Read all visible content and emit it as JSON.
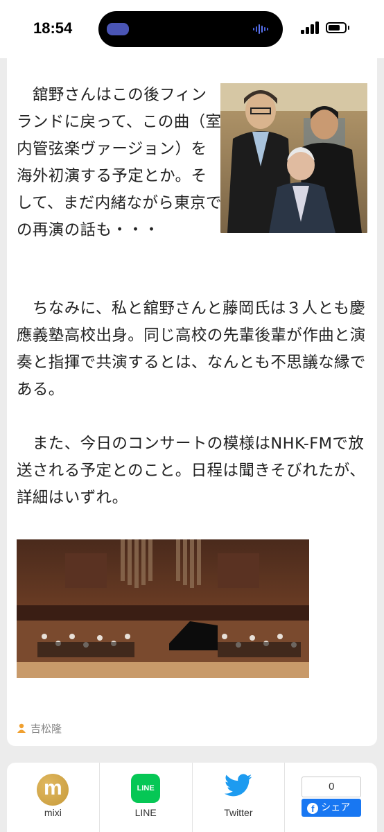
{
  "status_bar": {
    "time": "18:54"
  },
  "article": {
    "paragraph1": "　舘野さんはこの後フィンランドに戻って、この曲（室内管弦楽ヴァージョン）を海外初演する予定とか。そして、まだ内緒ながら東京での再演の話も・・・",
    "paragraph2": "　ちなみに、私と舘野さんと藤岡氏は３人とも慶應義塾高校出身。同じ高校の先輩後輩が作曲と演奏と指揮で共演するとは、なんとも不思議な縁である。",
    "paragraph3": "　また、今日のコンサートの模様はNHK-FMで放送される予定とのこと。日程は聞きそびれたが、詳細はいずれ。",
    "author": "吉松隆"
  },
  "share_bar": {
    "items": [
      {
        "label": "mixi",
        "icon": "mixi-icon"
      },
      {
        "label": "LINE",
        "icon": "line-icon",
        "icon_text": "LINE"
      },
      {
        "label": "Twitter",
        "icon": "twitter-bird-icon"
      }
    ],
    "facebook": {
      "count": "0",
      "button_label": "シェア"
    }
  },
  "colors": {
    "accent_orange": "#f0a030",
    "line_green": "#06c755",
    "twitter_blue": "#1d9bf0",
    "facebook_blue": "#1877f2",
    "mixi_gold": "#c79a3a"
  }
}
